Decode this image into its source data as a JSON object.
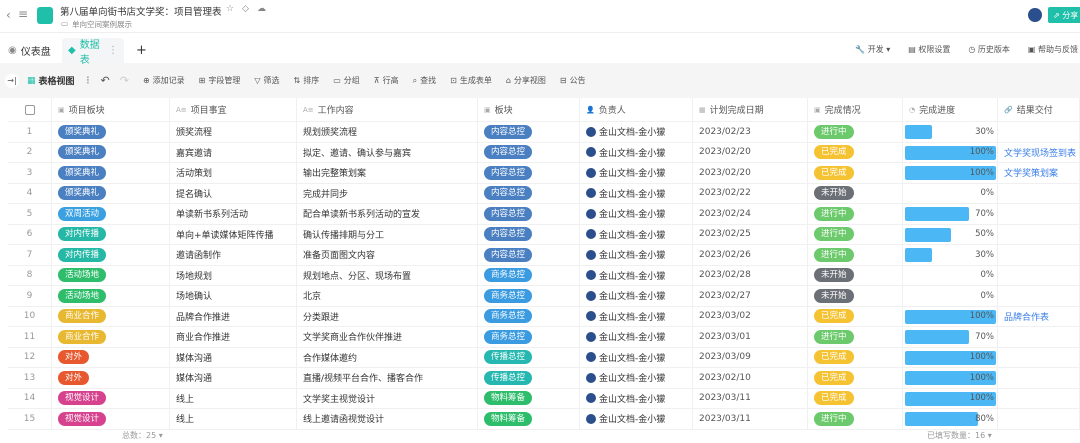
{
  "header": {
    "title": "第八届单向街书店文学奖：项目管理表",
    "folder": "单向空间案例展示",
    "share": "分享"
  },
  "tabs": [
    {
      "label": "仪表盘"
    },
    {
      "label": "数据表"
    }
  ],
  "right_tools": {
    "dev": "开发",
    "perm": "权限设置",
    "history": "历史版本",
    "help": "帮助与反馈"
  },
  "toolbar": {
    "view": "表格视图",
    "add": "添加记录",
    "fields": "字段管理",
    "filter": "筛选",
    "sort": "排序",
    "group": "分组",
    "rowheight": "行高",
    "find": "查找",
    "form": "生成表单",
    "shareview": "分享视图",
    "notice": "公告"
  },
  "columns": [
    "项目板块",
    "项目事宜",
    "工作内容",
    "板块",
    "负责人",
    "计划完成日期",
    "完成情况",
    "完成进度",
    "结果交付"
  ],
  "colors": {
    "颁奖典礼": "#4a7fc1",
    "双周活动": "#3aa0e0",
    "对内传播": "#26b8a6",
    "活动场地": "#2ebd6b",
    "商业合作": "#e8b830",
    "对外": "#e8582e",
    "视觉设计": "#d6428e",
    "内容总控": "#4a7fc1",
    "商务总控": "#3a9be0",
    "传播总控": "#26b8b0",
    "物料筹备": "#2ebd6b",
    "进行中": "#6cc96c",
    "已完成": "#f5c232",
    "未开始": "#6b6f76"
  },
  "rows": [
    {
      "n": "1",
      "block": "颁奖典礼",
      "item": "颁奖流程",
      "work": "规划颁奖流程",
      "section": "内容总控",
      "owner": "金山文档-金小獴",
      "date": "2023/02/23",
      "status": "进行中",
      "progress": 30,
      "pct": "30%",
      "result": ""
    },
    {
      "n": "2",
      "block": "颁奖典礼",
      "item": "嘉宾邀请",
      "work": "拟定、邀请、确认参与嘉宾",
      "section": "内容总控",
      "owner": "金山文档-金小獴",
      "date": "2023/02/20",
      "status": "已完成",
      "progress": 100,
      "pct": "100%",
      "result": "文学奖现场签到表"
    },
    {
      "n": "3",
      "block": "颁奖典礼",
      "item": "活动策划",
      "work": "输出完整策划案",
      "section": "内容总控",
      "owner": "金山文档-金小獴",
      "date": "2023/02/20",
      "status": "已完成",
      "progress": 100,
      "pct": "100%",
      "result": "文学奖策划案"
    },
    {
      "n": "4",
      "block": "颁奖典礼",
      "item": "提名确认",
      "work": "完成并同步",
      "section": "内容总控",
      "owner": "金山文档-金小獴",
      "date": "2023/02/22",
      "status": "未开始",
      "progress": 0,
      "pct": "0%",
      "result": ""
    },
    {
      "n": "5",
      "block": "双周活动",
      "item": "单读新书系列活动",
      "work": "配合单读新书系列活动的宣发",
      "section": "内容总控",
      "owner": "金山文档-金小獴",
      "date": "2023/02/24",
      "status": "进行中",
      "progress": 70,
      "pct": "70%",
      "result": ""
    },
    {
      "n": "6",
      "block": "对内传播",
      "item": "单向+单读媒体矩阵传播",
      "work": "确认传播排期与分工",
      "section": "内容总控",
      "owner": "金山文档-金小獴",
      "date": "2023/02/25",
      "status": "进行中",
      "progress": 50,
      "pct": "50%",
      "result": ""
    },
    {
      "n": "7",
      "block": "对内传播",
      "item": "邀请函制作",
      "work": "准备页面图文内容",
      "section": "内容总控",
      "owner": "金山文档-金小獴",
      "date": "2023/02/26",
      "status": "进行中",
      "progress": 30,
      "pct": "30%",
      "result": ""
    },
    {
      "n": "8",
      "block": "活动场地",
      "item": "场地规划",
      "work": "规划地点、分区、现场布置",
      "section": "商务总控",
      "owner": "金山文档-金小獴",
      "date": "2023/02/28",
      "status": "未开始",
      "progress": 0,
      "pct": "0%",
      "result": ""
    },
    {
      "n": "9",
      "block": "活动场地",
      "item": "场地确认",
      "work": "北京",
      "section": "商务总控",
      "owner": "金山文档-金小獴",
      "date": "2023/02/27",
      "status": "未开始",
      "progress": 0,
      "pct": "0%",
      "result": ""
    },
    {
      "n": "10",
      "block": "商业合作",
      "item": "品牌合作推进",
      "work": "分类跟进",
      "section": "商务总控",
      "owner": "金山文档-金小獴",
      "date": "2023/03/02",
      "status": "已完成",
      "progress": 100,
      "pct": "100%",
      "result": "品牌合作表"
    },
    {
      "n": "11",
      "block": "商业合作",
      "item": "商业合作推进",
      "work": "文学奖商业合作伙伴推进",
      "section": "商务总控",
      "owner": "金山文档-金小獴",
      "date": "2023/03/01",
      "status": "进行中",
      "progress": 70,
      "pct": "70%",
      "result": ""
    },
    {
      "n": "12",
      "block": "对外",
      "item": "媒体沟通",
      "work": "合作媒体邀约",
      "section": "传播总控",
      "owner": "金山文档-金小獴",
      "date": "2023/03/09",
      "status": "已完成",
      "progress": 100,
      "pct": "100%",
      "result": ""
    },
    {
      "n": "13",
      "block": "对外",
      "item": "媒体沟通",
      "work": "直播/视频平台合作、播客合作",
      "section": "传播总控",
      "owner": "金山文档-金小獴",
      "date": "2023/02/10",
      "status": "已完成",
      "progress": 100,
      "pct": "100%",
      "result": ""
    },
    {
      "n": "14",
      "block": "视觉设计",
      "item": "线上",
      "work": "文学奖主视觉设计",
      "section": "物料筹备",
      "owner": "金山文档-金小獴",
      "date": "2023/03/11",
      "status": "已完成",
      "progress": 100,
      "pct": "100%",
      "result": ""
    },
    {
      "n": "15",
      "block": "视觉设计",
      "item": "线上",
      "work": "线上邀请函视觉设计",
      "section": "物料筹备",
      "owner": "金山文档-金小獴",
      "date": "2023/03/11",
      "status": "进行中",
      "progress": 80,
      "pct": "80%",
      "result": ""
    }
  ],
  "footer": {
    "total": "总数：25",
    "filled": "已填写数量：16"
  }
}
